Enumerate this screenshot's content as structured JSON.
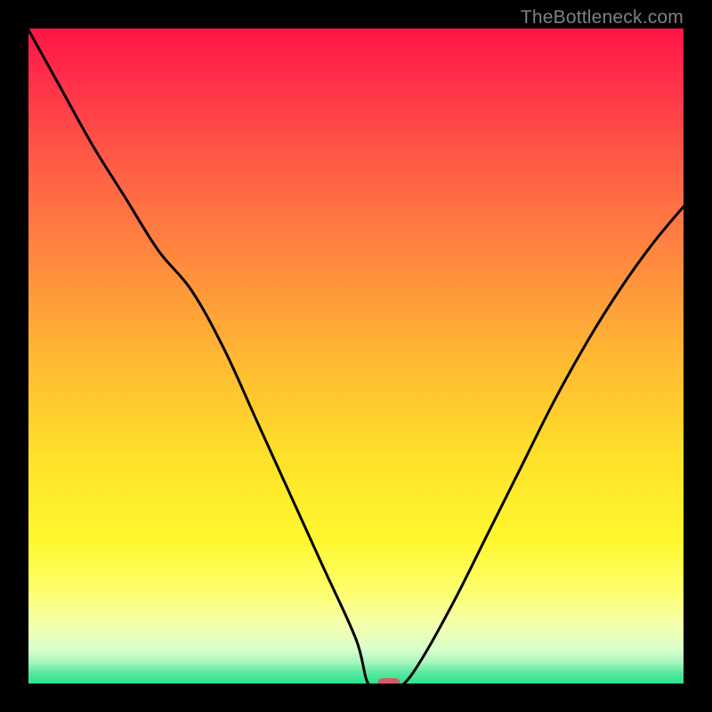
{
  "watermark": "TheBottleneck.com",
  "colors": {
    "frame": "#000000",
    "curve": "#000000",
    "marker": "#d35b66",
    "watermark": "#808080"
  },
  "chart_data": {
    "type": "line",
    "title": "",
    "xlabel": "",
    "ylabel": "",
    "xlim": [
      0,
      100
    ],
    "ylim": [
      0,
      100
    ],
    "x": [
      0,
      5,
      10,
      15,
      20,
      25,
      30,
      35,
      40,
      45,
      50,
      52,
      55,
      57,
      60,
      65,
      70,
      75,
      80,
      85,
      90,
      95,
      100
    ],
    "y": [
      100,
      91,
      82,
      74,
      66,
      60,
      51,
      40,
      29,
      18,
      7,
      0,
      0,
      0,
      4,
      13,
      23,
      33,
      43,
      52,
      60,
      67,
      73
    ],
    "marker": {
      "x": 55,
      "y": 0
    },
    "background_gradient": {
      "stops": [
        {
          "pos": 0.0,
          "color": "#ff1446"
        },
        {
          "pos": 0.08,
          "color": "#ff2f4a"
        },
        {
          "pos": 0.2,
          "color": "#ff5a46"
        },
        {
          "pos": 0.35,
          "color": "#ff883f"
        },
        {
          "pos": 0.5,
          "color": "#ffb733"
        },
        {
          "pos": 0.65,
          "color": "#ffe02a"
        },
        {
          "pos": 0.78,
          "color": "#fff82e"
        },
        {
          "pos": 0.86,
          "color": "#fdff70"
        },
        {
          "pos": 0.91,
          "color": "#f3ffb0"
        },
        {
          "pos": 0.945,
          "color": "#d9ffca"
        },
        {
          "pos": 0.965,
          "color": "#a7f7c0"
        },
        {
          "pos": 0.98,
          "color": "#5de8a0"
        },
        {
          "pos": 1.0,
          "color": "#22e28f"
        }
      ]
    }
  }
}
